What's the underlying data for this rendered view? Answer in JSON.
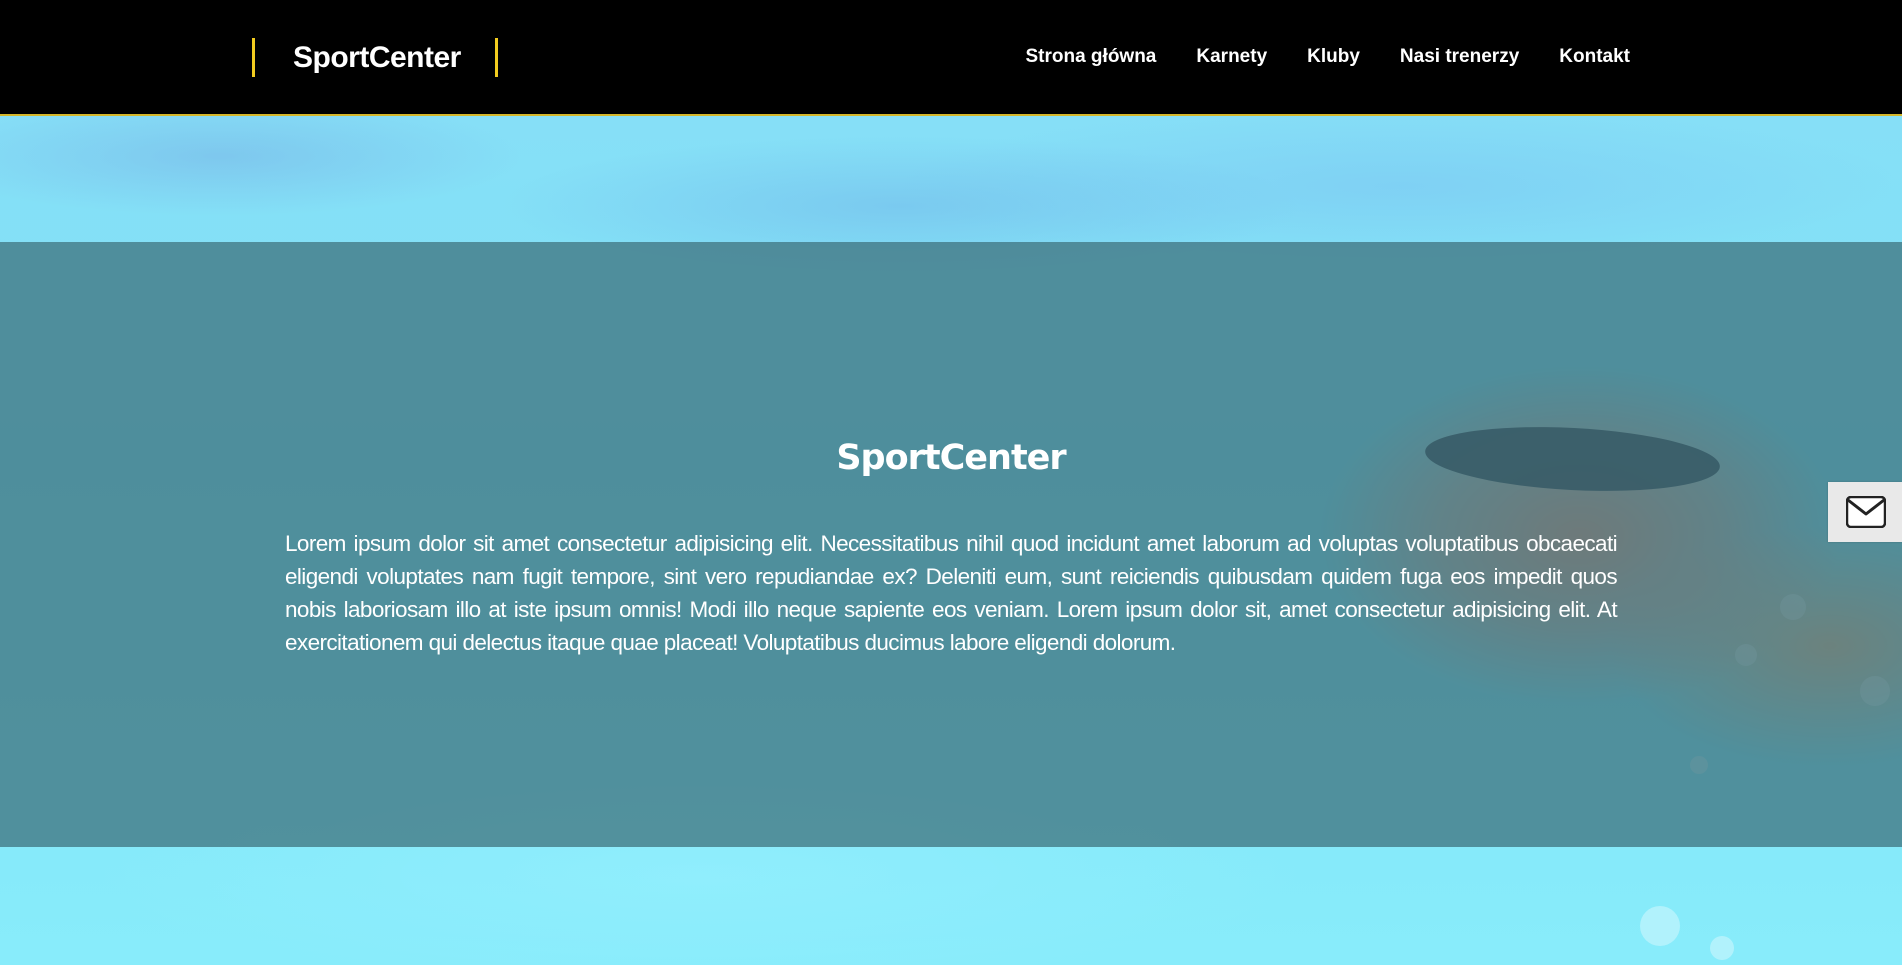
{
  "header": {
    "logo": "SportCenter",
    "nav": [
      {
        "label": "Strona główna"
      },
      {
        "label": "Karnety"
      },
      {
        "label": "Kluby"
      },
      {
        "label": "Nasi trenerzy"
      },
      {
        "label": "Kontakt"
      }
    ]
  },
  "hero": {
    "title": "SportCenter",
    "text": "Lorem ipsum dolor sit amet consectetur adipisicing elit. Necessitatibus nihil quod incidunt amet laborum ad voluptas voluptatibus obcaecati eligendi voluptates nam fugit tempore, sint vero repudiandae ex? Deleniti eum, sunt reiciendis quibusdam quidem fuga eos impedit quos nobis laboriosam illo at iste ipsum omnis! Modi illo neque sapiente eos veniam. Lorem ipsum dolor sit, amet consectetur adipisicing elit. At exercitationem qui delectus itaque quae placeat! Voluptatibus ducimus labore eligendi dolorum."
  },
  "contact_tab": {
    "icon": "envelope-icon"
  },
  "colors": {
    "header_bg": "#000000",
    "accent": "#f2cc1f",
    "overlay": "rgba(60,110,120,0.72)",
    "water": "#7fe3f6"
  }
}
